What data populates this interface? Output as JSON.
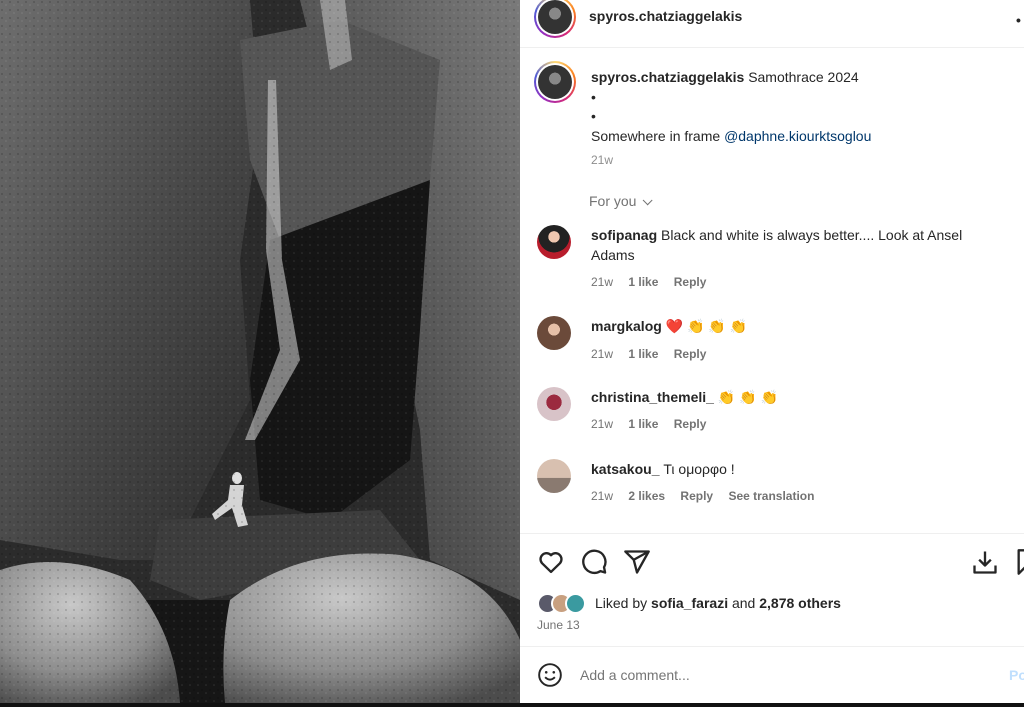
{
  "post": {
    "username": "spyros.chatziaggelakis",
    "caption_text": "Samothrace 2024",
    "bullet_1": "•",
    "bullet_2": "•",
    "caption_line": "Somewhere in frame",
    "mention": "@daphne.kiourktsoglou",
    "caption_age": "21w"
  },
  "for_you_label": "For you",
  "comments": [
    {
      "username": "sofipanag",
      "text": "Black and white is always better.... Look at Ansel Adams",
      "age": "21w",
      "likes": "1 like",
      "reply": "Reply",
      "avatar_color": "#b81d2c"
    },
    {
      "username": "margkalog",
      "text": "❤️ 👏 👏 👏",
      "age": "21w",
      "likes": "1 like",
      "reply": "Reply",
      "avatar_color": "#caa58f"
    },
    {
      "username": "christina_themeli_",
      "text": "👏 👏 👏",
      "age": "21w",
      "likes": "1 like",
      "reply": "Reply",
      "avatar_color": "#c9a4b0"
    },
    {
      "username": "katsakou_",
      "text": "Τι ομορφο !",
      "age": "21w",
      "likes": "2 likes",
      "reply": "Reply",
      "translate": "See translation",
      "avatar_color": "#d8b9a4"
    }
  ],
  "likes": {
    "prefix": "Liked by",
    "user": "sofia_farazi",
    "and": "and",
    "others": "2,878 others"
  },
  "date": "June 13",
  "add_comment_placeholder": "Add a comment...",
  "post_button": "Po",
  "more_icon": "•",
  "icons": {
    "like": "heart-icon",
    "comment": "comment-icon",
    "share": "share-icon",
    "save": "save-icon",
    "emoji": "emoji-icon"
  }
}
